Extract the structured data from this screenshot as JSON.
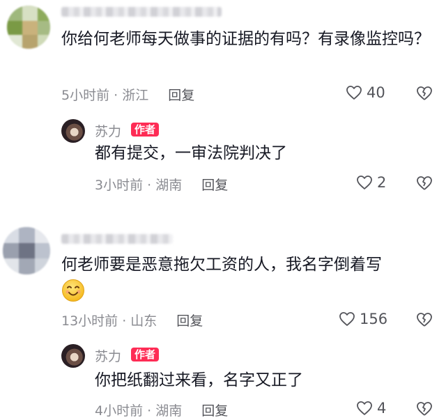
{
  "comments": [
    {
      "text": "你给何老师每天做事的证据的有吗？有录像监控吗？",
      "time": "5小时前 · 浙江",
      "reply_label": "回复",
      "likes": "40",
      "reply": {
        "author": "苏力",
        "badge": "作者",
        "text": "都有提交，一审法院判决了",
        "time": "3小时前 · 湖南",
        "reply_label": "回复",
        "likes": "2"
      }
    },
    {
      "text": "何老师要是恶意拖欠工资的人，我名字倒着写",
      "time": "13小时前 · 山东",
      "reply_label": "回复",
      "likes": "156",
      "reply": {
        "author": "苏力",
        "badge": "作者",
        "text": "你把纸翻过来看，名字又正了",
        "time": "4小时前 · 湖南",
        "reply_label": "回复",
        "likes": "4"
      }
    }
  ],
  "colors": {
    "badge": "#fe2c55",
    "meta": "#8a8b91",
    "text": "#161823"
  },
  "icons": {
    "like": "heart-icon",
    "dislike": "broken-heart-icon",
    "emoji": "smile-emoji"
  }
}
